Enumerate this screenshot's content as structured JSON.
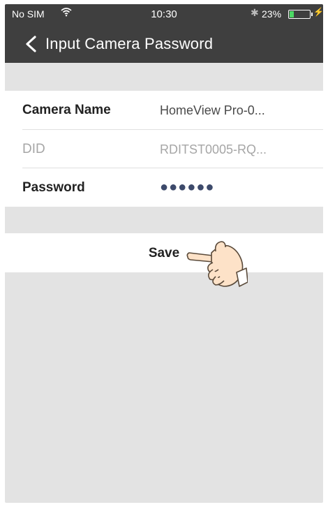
{
  "status_bar": {
    "carrier": "No SIM",
    "wifi_icon": "wifi-icon",
    "time": "10:30",
    "bluetooth_icon": "bluetooth-icon",
    "battery_percent": "23%",
    "battery_level": 0.23,
    "charging_icon": "bolt-icon",
    "battery_color": "#4cd964"
  },
  "nav": {
    "back_icon": "chevron-left-icon",
    "title": "Input Camera Password",
    "background": "#3f3f3f"
  },
  "form": {
    "rows": [
      {
        "label": "Camera Name",
        "value": "HomeView Pro-0..."
      },
      {
        "label": "DID",
        "value": "RDITST0005-RQ..."
      },
      {
        "label": "Password",
        "value": "●●●●●●"
      }
    ]
  },
  "actions": {
    "save_label": "Save"
  },
  "overlay": {
    "pointer_icon": "pointing-hand-icon"
  }
}
